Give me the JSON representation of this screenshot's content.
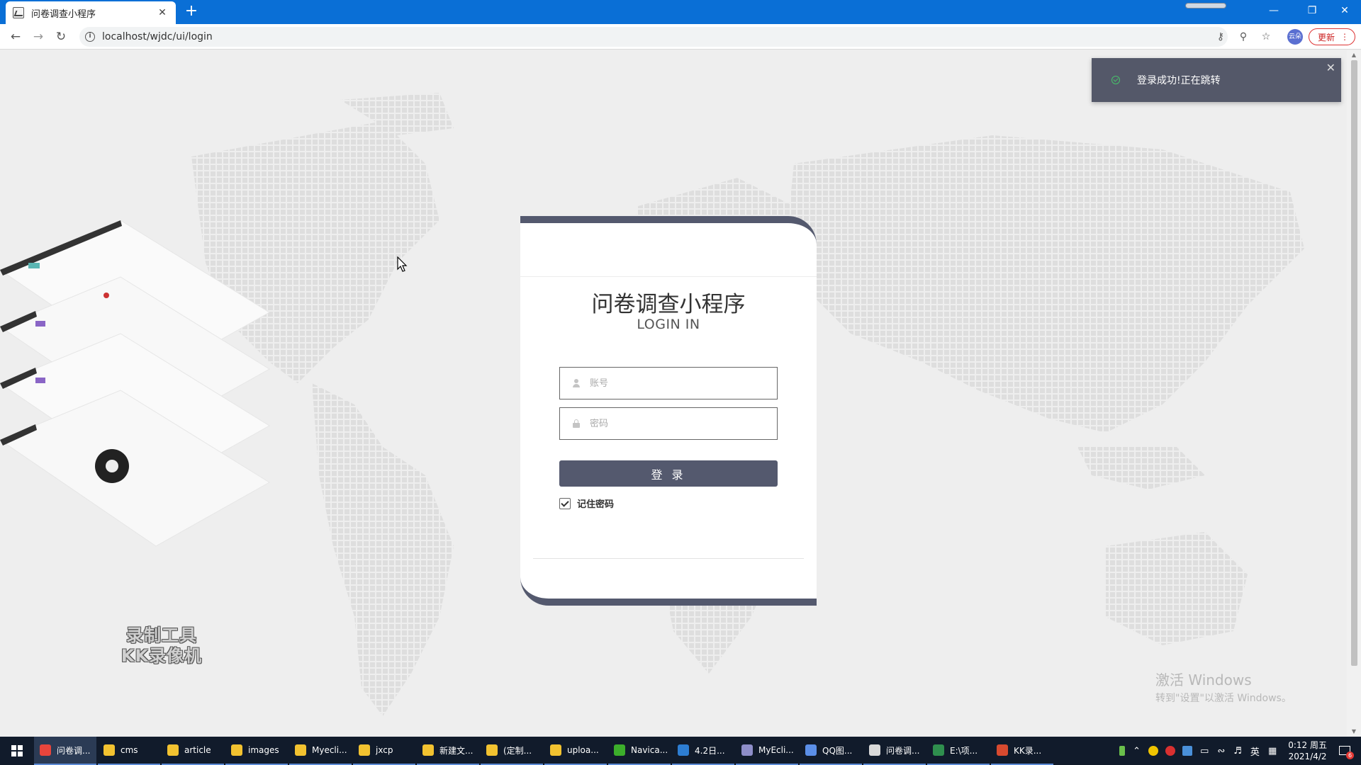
{
  "browser": {
    "tab_title": "问卷调查小程序",
    "tab_close": "✕",
    "new_tab": "+",
    "url": "localhost/wjdc/ui/login",
    "update_label": "更新",
    "profile_label": "云朵"
  },
  "toast": {
    "message": "登录成功!正在跳转",
    "close": "✕"
  },
  "login": {
    "title": "问卷调查小程序",
    "subtitle": "LOGIN IN",
    "username_placeholder": "账号",
    "password_placeholder": "密码",
    "submit_label": "登 录",
    "remember_label": "记住密码",
    "remember_checked": true
  },
  "overlay": {
    "recorder_line1": "录制工具",
    "recorder_line2": "KK录像机",
    "activation_title": "激活 Windows",
    "activation_sub": "转到\"设置\"以激活 Windows。"
  },
  "taskbar": {
    "items": [
      {
        "label": "问卷调...",
        "icon": "chrome-icon",
        "color": "#e8453c"
      },
      {
        "label": "cms",
        "icon": "folder-icon",
        "color": "#f2c230"
      },
      {
        "label": "article",
        "icon": "folder-icon",
        "color": "#f2c230"
      },
      {
        "label": "images",
        "icon": "folder-icon",
        "color": "#f2c230"
      },
      {
        "label": "Myecli...",
        "icon": "folder-icon",
        "color": "#f2c230"
      },
      {
        "label": "jxcp",
        "icon": "folder-icon",
        "color": "#f2c230"
      },
      {
        "label": "新建文...",
        "icon": "folder-icon",
        "color": "#f2c230"
      },
      {
        "label": "(定制...",
        "icon": "folder-icon",
        "color": "#f2c230"
      },
      {
        "label": "uploa...",
        "icon": "folder-icon",
        "color": "#f2c230"
      },
      {
        "label": "Navica...",
        "icon": "navicat-icon",
        "color": "#3cae2b"
      },
      {
        "label": "4.2日...",
        "icon": "vs-icon",
        "color": "#2d7dd2"
      },
      {
        "label": "MyEcli...",
        "icon": "eclipse-icon",
        "color": "#8e8ec9"
      },
      {
        "label": "QQ图...",
        "icon": "qq-icon",
        "color": "#5b8fe8"
      },
      {
        "label": "问卷调...",
        "icon": "wechat-icon",
        "color": "#d9d9d9"
      },
      {
        "label": "E:\\项...",
        "icon": "excel-icon",
        "color": "#2f8f4e"
      },
      {
        "label": "KK录...",
        "icon": "kk-icon",
        "color": "#d84a2f"
      }
    ],
    "tray_lang": "英",
    "clock_time": "0:12 周五",
    "clock_date": "2021/4/2",
    "notif_count": "6"
  }
}
